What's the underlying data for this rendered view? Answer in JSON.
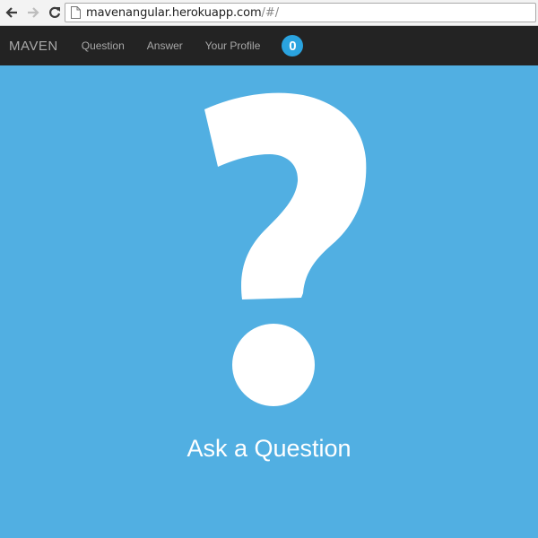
{
  "browser": {
    "url_domain": "mavenangular.herokuapp.com",
    "url_path": "/#/",
    "back_icon": "back-arrow-icon",
    "forward_icon": "forward-arrow-icon",
    "reload_icon": "reload-icon",
    "page_icon": "page-icon"
  },
  "navbar": {
    "brand": "MAVEN",
    "links": [
      "Question",
      "Answer",
      "Your Profile"
    ],
    "badge_count": "0"
  },
  "hero": {
    "icon": "question-mark-icon",
    "cta_label": "Ask a Question"
  },
  "colors": {
    "background": "#51afe2",
    "navbar": "#232323",
    "badge": "#2aa3df",
    "foreground": "#ffffff"
  }
}
